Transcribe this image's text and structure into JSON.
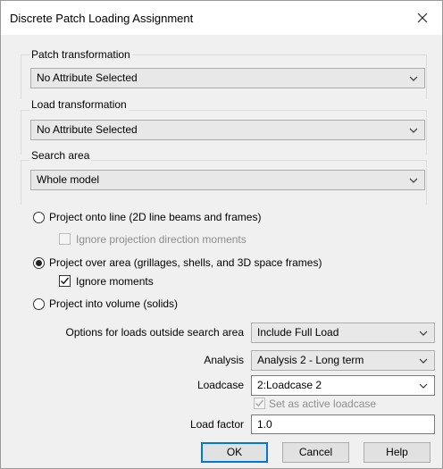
{
  "window": {
    "title": "Discrete Patch Loading Assignment"
  },
  "patch_transformation": {
    "label": "Patch transformation",
    "value": "No Attribute Selected"
  },
  "load_transformation": {
    "label": "Load transformation",
    "value": "No Attribute Selected"
  },
  "search_area": {
    "label": "Search area",
    "value": "Whole model"
  },
  "projection": {
    "line": {
      "label": "Project onto line (2D line beams and frames)",
      "checked": false
    },
    "ignore_projection": {
      "label": "Ignore projection direction moments",
      "checked": false,
      "enabled": false
    },
    "area": {
      "label": "Project over area (grillages, shells, and 3D space frames)",
      "checked": true
    },
    "ignore_moments": {
      "label": "Ignore moments",
      "checked": true,
      "enabled": true
    },
    "volume": {
      "label": "Project into volume (solids)",
      "checked": false
    }
  },
  "options": {
    "outside_label": "Options for loads outside search area",
    "outside_value": "Include Full Load",
    "analysis_label": "Analysis",
    "analysis_value": "Analysis 2 - Long term",
    "loadcase_label": "Loadcase",
    "loadcase_value": "2:Loadcase 2",
    "set_active_label": "Set as active loadcase",
    "set_active_checked": true,
    "load_factor_label": "Load factor",
    "load_factor_value": "1.0"
  },
  "buttons": {
    "ok": "OK",
    "cancel": "Cancel",
    "help": "Help"
  }
}
